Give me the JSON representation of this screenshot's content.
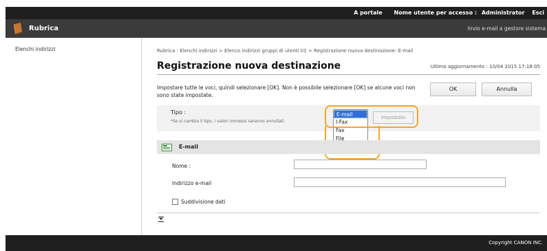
{
  "topbar": {
    "portal_link": "A portale",
    "login_user_label": "Nome utente per accesso :",
    "login_user_value": "Administrator",
    "logout_link": "Esci"
  },
  "titlebar": {
    "app_title": "Rubrica",
    "send_mail_link": "Invio e-mail a gestore sistema"
  },
  "sidebar": {
    "items": [
      {
        "label": "Elenchi indirizzi"
      }
    ]
  },
  "main": {
    "breadcrumb": "Rubrica : Elenchi indirizzi > Elenco indirizzi gruppi di utenti 01 > Registrazione nuova destinazione: E-mail",
    "page_title": "Registrazione nuova destinazione",
    "last_updated": "Ultimo aggiornamento : 10/04 2015 17:18:05",
    "instructions": "Impostare tutte le voci, quindi selezionare [OK]. Non è possibile selezionare [OK] se alcune voci non sono state impostate.",
    "ok_label": "OK",
    "cancel_label": "Annulla",
    "tipo": {
      "label": "Tipo :",
      "note": "*Se si cambia il tipo, i valori immessi saranno annullati.",
      "options": [
        "E-mail",
        "I-Fax",
        "Fax",
        "File"
      ],
      "selected": "E-mail",
      "set_button": "Impostato"
    },
    "email_section": {
      "title": "E-mail",
      "name_label": "Nome :",
      "name_value": "",
      "email_label": "Indirizzo e-mail",
      "email_value": "",
      "split_label": "Suddivisione dati"
    }
  },
  "footer": {
    "copyright": "Copyright CANON INC."
  },
  "colors": {
    "highlight": "#f5a623",
    "selected_option": "#2f6fd6",
    "topbar": "#1f1f1f",
    "titlebar": "#3b3b3b"
  }
}
